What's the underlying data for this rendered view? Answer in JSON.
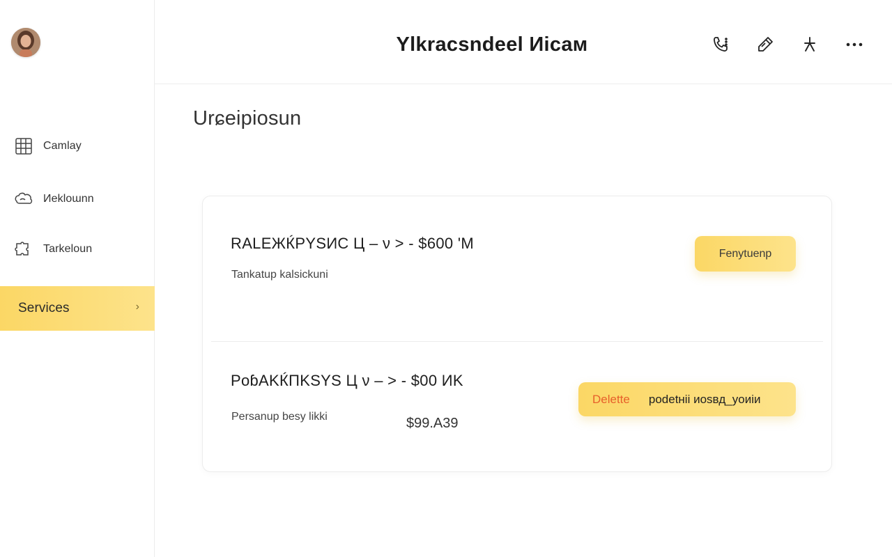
{
  "header": {
    "title": "Ylkracsndeel Иicaм",
    "actions": [
      {
        "icon": "phone-icon"
      },
      {
        "icon": "pencil-icon"
      },
      {
        "icon": "tools-icon"
      },
      {
        "icon": "more-icon"
      }
    ]
  },
  "sidebar": {
    "avatar_icon": "user-avatar",
    "items": [
      {
        "label": "Camlay",
        "icon": "grid-calendar-icon",
        "active": false
      },
      {
        "label": "Иekloɯnn",
        "icon": "cloud-hand-icon",
        "active": false
      },
      {
        "label": "Tarkeloun",
        "icon": "puzzle-icon",
        "active": false
      },
      {
        "label": "Services",
        "icon": "chevron-right-icon",
        "active": true
      }
    ],
    "chevron": "›"
  },
  "main": {
    "heading": "Urɕeipiosun",
    "services": [
      {
        "title": "RALEЖЌPYSИC Ц – ν >  - $600 'M",
        "subtitle": "Tankatup kalsickuni",
        "price": "",
        "button_label": "Fenytuenp"
      },
      {
        "title": "PoɓAKЌПKSYS Ц  ν – >  - $00 ИK",
        "subtitle": "Persanup besy likki",
        "price": "$99.A39",
        "delete_label": "Delette",
        "secondary_label": "podetнii иosвд_yoиiи"
      }
    ]
  },
  "colors": {
    "accent": "#fbd765",
    "accent_light": "#fde38b",
    "danger_text": "#e7602a",
    "border": "#ececec"
  }
}
